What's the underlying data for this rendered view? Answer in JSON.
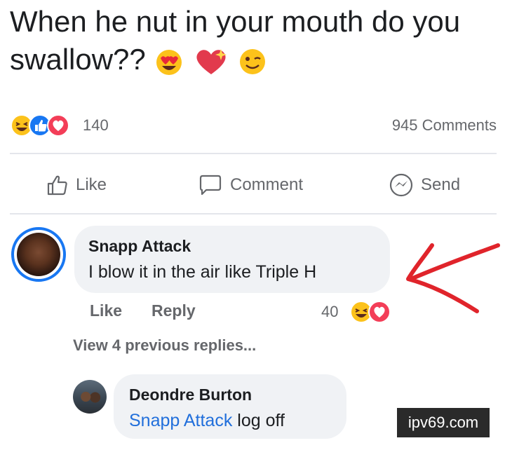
{
  "post": {
    "text": "When he nut in your mouth do you swallow??",
    "emojis": [
      "heart-eyes-emoji",
      "sparkling-heart-emoji",
      "winking-face-emoji"
    ]
  },
  "reactions": {
    "icons": [
      "haha-reaction-icon",
      "like-reaction-icon",
      "love-reaction-icon"
    ],
    "count": "140",
    "comments_label": "945 Comments"
  },
  "actions": {
    "like": "Like",
    "comment": "Comment",
    "send": "Send"
  },
  "comment": {
    "author": "Snapp Attack",
    "text": "I blow it in the air like Triple H",
    "like": "Like",
    "reply": "Reply",
    "reaction_count": "40",
    "reaction_icons": [
      "haha-reaction-icon",
      "love-reaction-icon"
    ]
  },
  "view_previous": "View 4 previous replies...",
  "reply": {
    "author": "Deondre Burton",
    "mention": "Snapp Attack",
    "text": "log off"
  },
  "annotation": {
    "arrow_color": "#e0242b"
  },
  "watermark": "ipv69.com",
  "colors": {
    "facebook_blue": "#1877f2",
    "meta_gray": "#65676b",
    "bubble_gray": "#f0f2f5",
    "mention_blue": "#216fdb"
  }
}
